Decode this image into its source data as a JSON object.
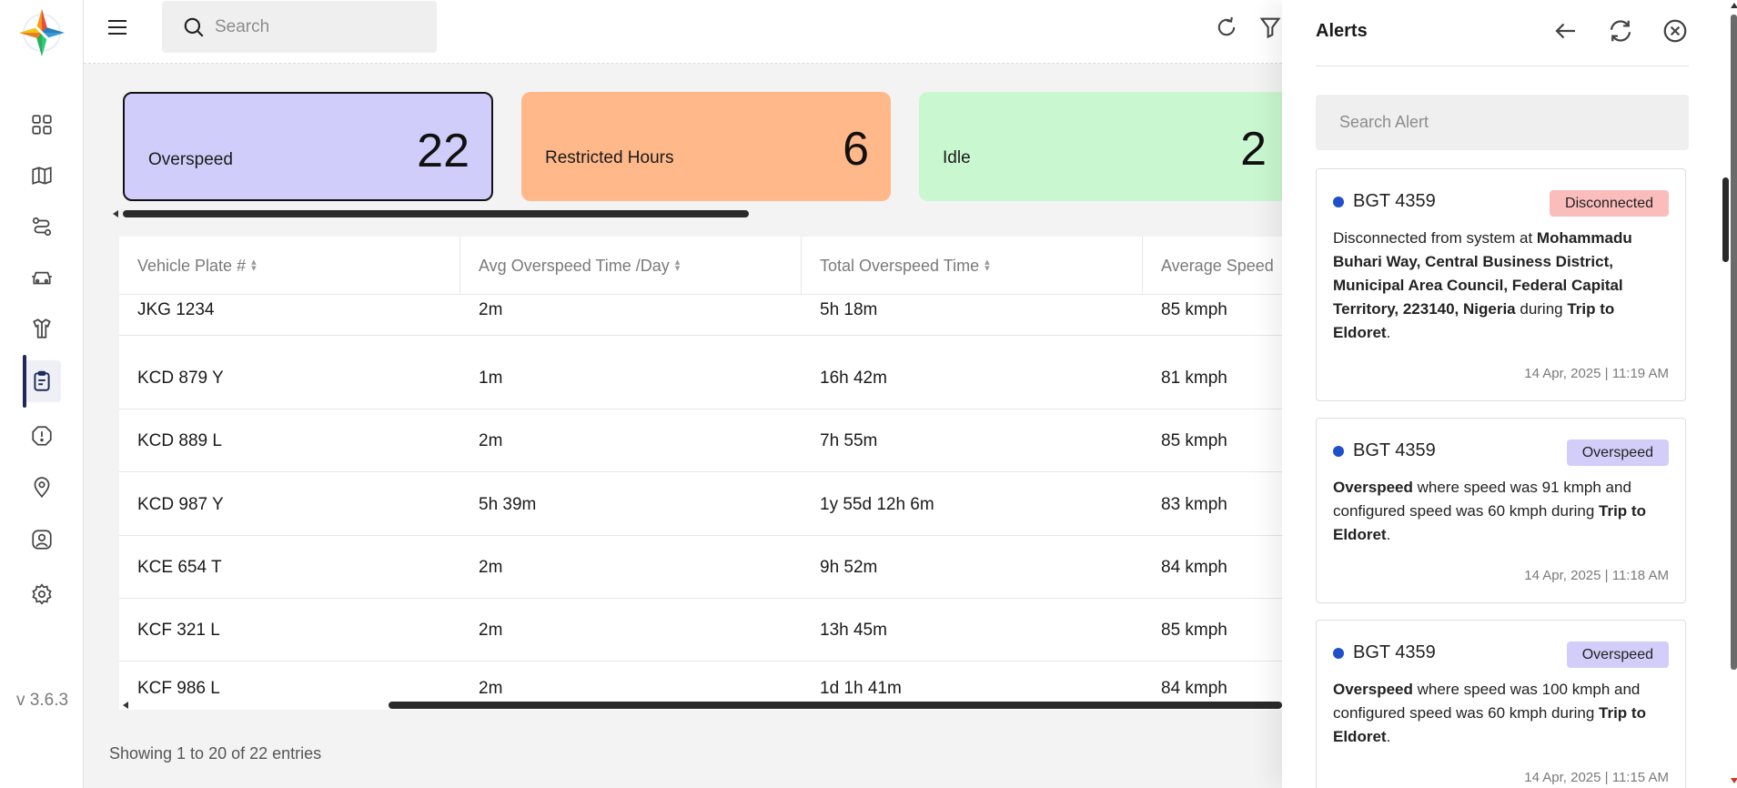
{
  "app": {
    "version": "v 3.6.3"
  },
  "nav": {
    "items": [
      {
        "name": "dashboard-icon"
      },
      {
        "name": "map-icon"
      },
      {
        "name": "route-icon"
      },
      {
        "name": "vehicle-icon"
      },
      {
        "name": "driver-icon"
      },
      {
        "name": "reports-icon",
        "active": true
      },
      {
        "name": "alert-icon"
      },
      {
        "name": "geofence-icon"
      },
      {
        "name": "user-icon"
      },
      {
        "name": "settings-icon"
      }
    ]
  },
  "topbar": {
    "search_placeholder": "Search"
  },
  "summary": {
    "cards": [
      {
        "label": "Overspeed",
        "value": "22",
        "color": "#d0cdfa"
      },
      {
        "label": "Restricted Hours",
        "value": "6",
        "color": "#ffb88a"
      },
      {
        "label": "Idle",
        "value": "2",
        "color": "#c9f7cf"
      }
    ]
  },
  "table": {
    "headers": [
      "Vehicle Plate #",
      "Avg Overspeed Time /Day",
      "Total Overspeed Time",
      "Average Speed"
    ],
    "rows": [
      [
        "JKG 1234",
        "2m",
        "5h 18m",
        "85 kmph"
      ],
      [
        "KCD 879 Y",
        "1m",
        "16h 42m",
        "81 kmph"
      ],
      [
        "KCD 889 L",
        "2m",
        "7h 55m",
        "85 kmph"
      ],
      [
        "KCD 987 Y",
        "5h 39m",
        "1y 55d 12h 6m",
        "83 kmph"
      ],
      [
        "KCE 654 T",
        "2m",
        "9h 52m",
        "84 kmph"
      ],
      [
        "KCF 321 L",
        "2m",
        "13h 45m",
        "85 kmph"
      ],
      [
        "KCF 986 L",
        "2m",
        "1d 1h 41m",
        "84 kmph"
      ]
    ],
    "footer": "Showing 1 to 20 of 22 entries"
  },
  "alerts": {
    "title": "Alerts",
    "search_placeholder": "Search Alert",
    "items": [
      {
        "plate": "BGT 4359",
        "badge": "Disconnected",
        "badge_color": "#fbbcbc",
        "body_parts": [
          {
            "t": "Disconnected from system at ",
            "b": false
          },
          {
            "t": "Mohammadu Buhari Way, Central Business District, Municipal Area Council, Federal Capital Territory, 223140, Nigeria",
            "b": true
          },
          {
            "t": " during ",
            "b": false
          },
          {
            "t": "Trip to Eldoret",
            "b": true
          },
          {
            "t": ".",
            "b": false
          }
        ],
        "time": "14 Apr, 2025 | 11:19 AM"
      },
      {
        "plate": "BGT 4359",
        "badge": "Overspeed",
        "badge_color": "#d2cdf9",
        "body_parts": [
          {
            "t": "Overspeed",
            "b": true
          },
          {
            "t": " where speed was 91 kmph and configured speed was 60 kmph during ",
            "b": false
          },
          {
            "t": "Trip to Eldoret",
            "b": true
          },
          {
            "t": ".",
            "b": false
          }
        ],
        "time": "14 Apr, 2025 | 11:18 AM"
      },
      {
        "plate": "BGT 4359",
        "badge": "Overspeed",
        "badge_color": "#d2cdf9",
        "body_parts": [
          {
            "t": "Overspeed",
            "b": true
          },
          {
            "t": " where speed was 100 kmph and configured speed was 60 kmph during ",
            "b": false
          },
          {
            "t": "Trip to Eldoret",
            "b": true
          },
          {
            "t": ".",
            "b": false
          }
        ],
        "time": "14 Apr, 2025 | 11:15 AM"
      }
    ]
  }
}
